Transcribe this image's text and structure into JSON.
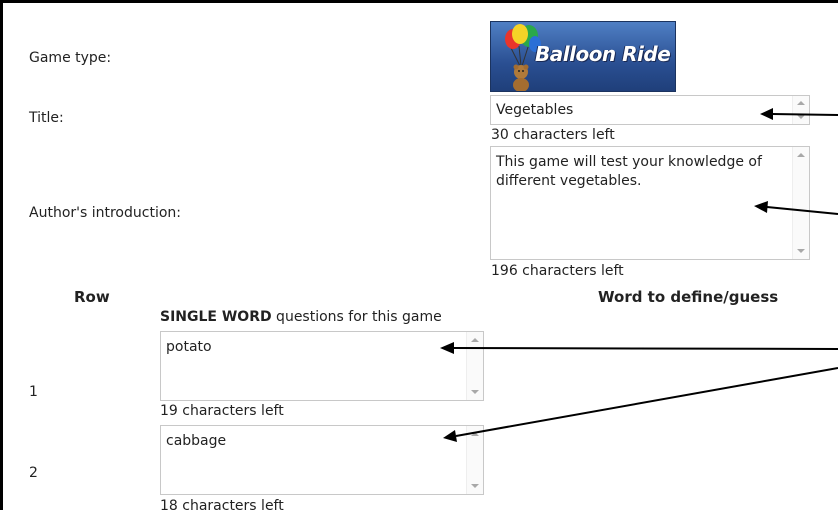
{
  "form": {
    "game_type_label": "Game type:",
    "title_label": "Title:",
    "intro_label": "Author's introduction:",
    "logo_text": "Balloon Ride",
    "title_value": "Vegetables",
    "title_counter": "30 characters left",
    "intro_value": "This game will test your knowledge of different vegetables.",
    "intro_counter": "196 characters left"
  },
  "table": {
    "row_header": "Row",
    "word_header": "Word to define/guess",
    "subheader_bold": "SINGLE WORD",
    "subheader_rest": " questions for this game",
    "rows": [
      {
        "num": "1",
        "value": "potato",
        "counter": "19 characters left"
      },
      {
        "num": "2",
        "value": "cabbage",
        "counter": "18 characters left"
      }
    ]
  },
  "icons": {
    "logo_icon": "balloons-with-teddy-bear-icon",
    "annotation": "arrow-icon"
  }
}
